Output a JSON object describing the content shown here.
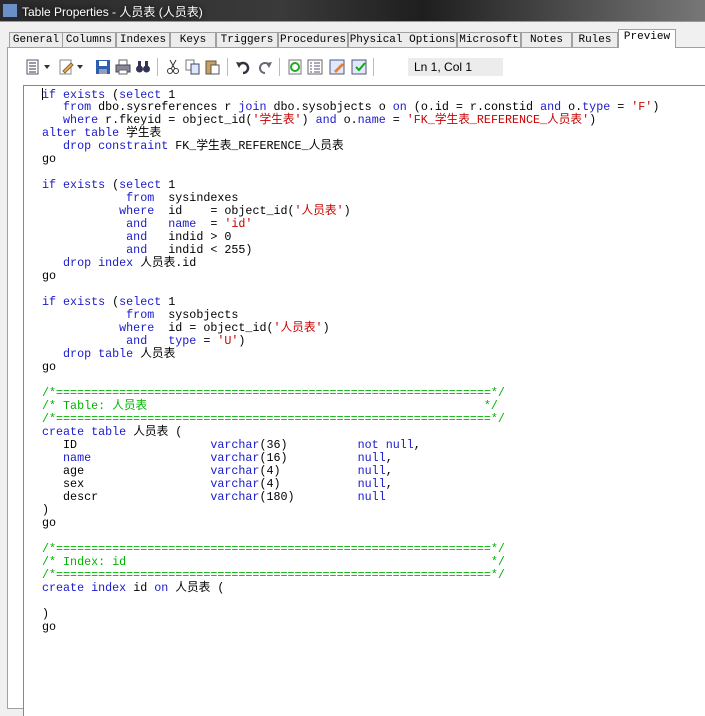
{
  "window": {
    "title": "Table Properties - 人员表 (人员表)",
    "icon": "table-icon"
  },
  "tabs": [
    {
      "label": "General",
      "active": false
    },
    {
      "label": "Columns",
      "active": false
    },
    {
      "label": "Indexes",
      "active": false
    },
    {
      "label": "Keys",
      "active": false
    },
    {
      "label": "Triggers",
      "active": false
    },
    {
      "label": "Procedures",
      "active": false
    },
    {
      "label": "Physical Options",
      "active": false
    },
    {
      "label": "Microsoft",
      "active": false
    },
    {
      "label": "Notes",
      "active": false
    },
    {
      "label": "Rules",
      "active": false
    },
    {
      "label": "Preview",
      "active": true
    }
  ],
  "toolbar": {
    "buttons": [
      "script-options-icon",
      "edit-icon",
      "save-icon",
      "print-icon",
      "find-icon",
      "cut-icon",
      "copy-icon",
      "paste-icon",
      "undo-icon",
      "redo-icon",
      "refresh-icon",
      "properties-icon",
      "edit-script-icon",
      "check-icon"
    ],
    "cursor_position": "Ln 1, Col 1"
  },
  "colors": {
    "keyword": "#1a1acc",
    "string": "#c80000",
    "comment": "#00b400"
  },
  "editor": {
    "keywords": [
      "if",
      "exists",
      "select",
      "from",
      "join",
      "on",
      "and",
      "where",
      "alter",
      "table",
      "drop",
      "constraint",
      "index",
      "create",
      "type",
      "name",
      "varchar",
      "not",
      "null"
    ],
    "lines": [
      "if exists (select 1",
      "   from dbo.sysreferences r join dbo.sysobjects o on (o.id = r.constid and o.type = 'F')",
      "   where r.fkeyid = object_id('学生表') and o.name = 'FK_学生表_REFERENCE_人员表')",
      "alter table 学生表",
      "   drop constraint FK_学生表_REFERENCE_人员表",
      "go",
      "",
      "if exists (select 1",
      "            from  sysindexes",
      "           where  id    = object_id('人员表')",
      "            and   name  = 'id'",
      "            and   indid > 0",
      "            and   indid < 255)",
      "   drop index 人员表.id",
      "go",
      "",
      "if exists (select 1",
      "            from  sysobjects",
      "           where  id = object_id('人员表')",
      "            and   type = 'U')",
      "   drop table 人员表",
      "go",
      "",
      "/*==============================================================*/",
      "/* Table: 人员表                                                */",
      "/*==============================================================*/",
      "create table 人员表 (",
      "   ID                   varchar(36)          not null,",
      "   name                 varchar(16)          null,",
      "   age                  varchar(4)           null,",
      "   sex                  varchar(4)           null,",
      "   descr                varchar(180)         null",
      ")",
      "go",
      "",
      "/*==============================================================*/",
      "/* Index: id                                                    */",
      "/*==============================================================*/",
      "create index id on 人员表 (",
      "",
      ")",
      "go"
    ]
  }
}
